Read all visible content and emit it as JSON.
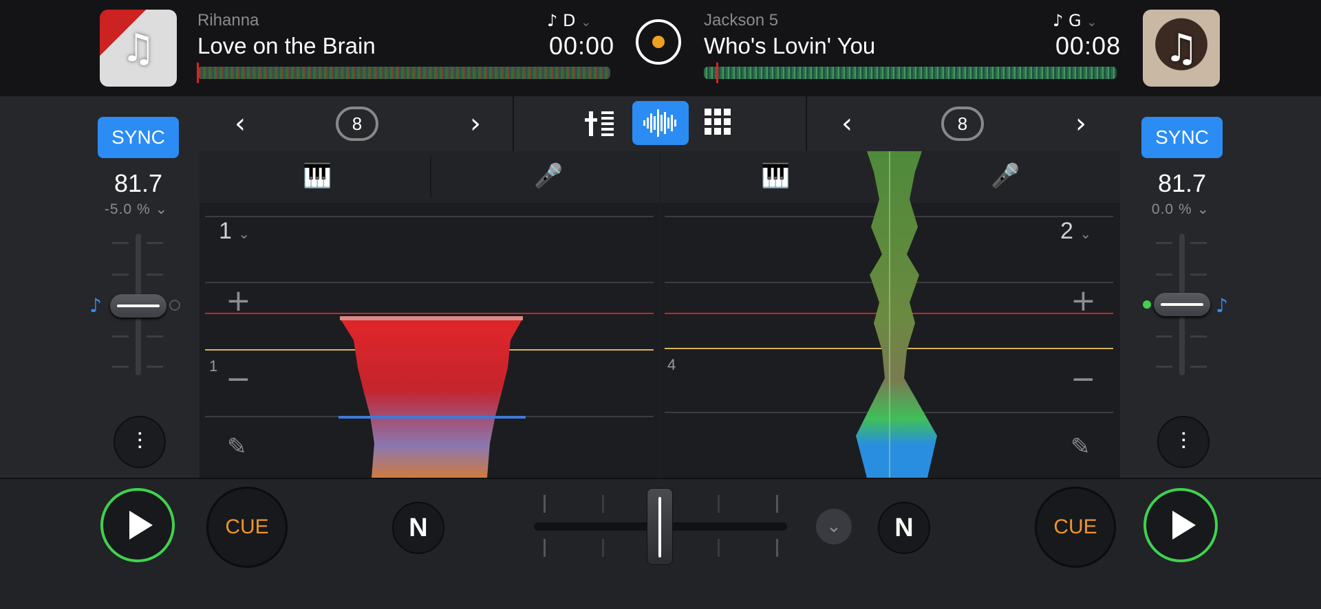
{
  "deck_a": {
    "artist": "Rihanna",
    "title": "Love on the Brain",
    "key": "D",
    "time": "00:00",
    "sync_label": "SYNC",
    "bpm": "81.7",
    "pitch": "-5.0 %",
    "deck_number": "1",
    "cue_number": "1",
    "cue_label": "CUE",
    "loop_size": "8"
  },
  "deck_b": {
    "artist": "Jackson 5",
    "title": "Who's Lovin' You",
    "key": "G",
    "time": "00:08",
    "sync_label": "SYNC",
    "bpm": "81.7",
    "pitch": "0.0 %",
    "deck_number": "2",
    "cue_number": "4",
    "cue_label": "CUE",
    "loop_size": "8"
  },
  "icons": {
    "music_note": "♪",
    "album_placeholder": "♫",
    "prev": "‹",
    "next": "›",
    "chevron_down": "⌄",
    "plus": "+",
    "minus": "−",
    "pencil": "✎",
    "piano": "🎹",
    "mic": "🎤",
    "mixer": "⫶",
    "grid": "⋮⋮⋮"
  },
  "colors": {
    "accent_blue": "#2b8cf4",
    "play_green": "#3fd24f",
    "cue_orange": "#f0962a",
    "cue_line_red": "#c8262a",
    "cue_line_yellow": "#d8b35a"
  }
}
